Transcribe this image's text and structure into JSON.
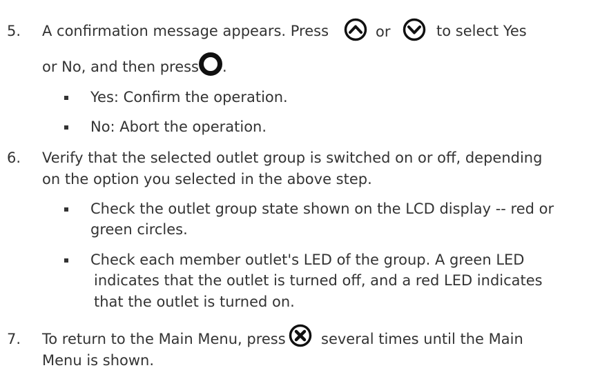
{
  "step5": {
    "number": "5.",
    "line1_a": "A confirmation message appears. Press",
    "line1_or": "or",
    "line1_b": "to select Yes",
    "line2_a": "or No, and then press",
    "line2_b": ".",
    "bullets": [
      "Yes: Confirm the operation.",
      "No: Abort the operation."
    ],
    "icons": [
      "up-arrow-button-icon",
      "down-arrow-button-icon",
      "ok-button-icon"
    ]
  },
  "step6": {
    "number": "6.",
    "line1": "Verify that the selected outlet group is switched on or off, depending",
    "line2": "on the option you selected in the above step.",
    "bullet1": [
      "Check the outlet group state shown on the LCD display -- red or",
      "green circles."
    ],
    "bullet2": [
      "Check each member outlet's LED of the group. A green LED",
      "indicates that the outlet is turned off, and a red LED indicates",
      "that the outlet is turned on."
    ]
  },
  "step7": {
    "number": "7.",
    "line1_a": "To return to the Main Menu, press",
    "line1_b": "several times until the Main",
    "line2": "Menu is shown.",
    "icon": "cancel-x-button-icon"
  }
}
